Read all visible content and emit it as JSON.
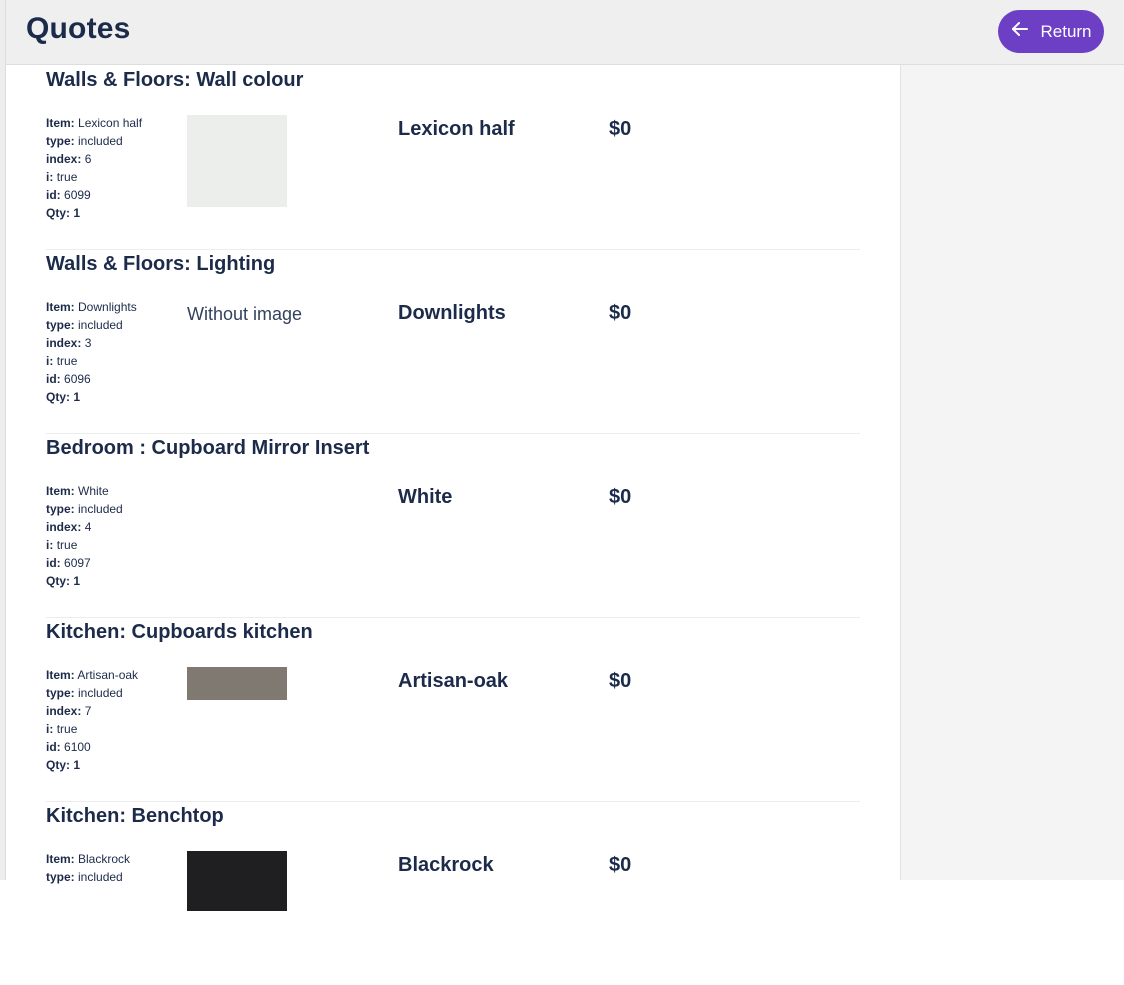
{
  "header": {
    "title": "Quotes",
    "return_label": "Return",
    "accent_color": "#6c3fc4"
  },
  "sections": [
    {
      "title": "Walls & Floors: Wall colour",
      "item": "Lexicon half",
      "type": "included",
      "index": "6",
      "i": "true",
      "id": "6099",
      "qty": "1",
      "name": "Lexicon half",
      "price": "$0",
      "thumb_color": "#eceeec"
    },
    {
      "title": "Walls & Floors: Lighting",
      "item": "Downlights",
      "type": "included",
      "index": "3",
      "i": "true",
      "id": "6096",
      "qty": "1",
      "no_image_text": "Without image",
      "name": "Downlights",
      "price": "$0"
    },
    {
      "title": "Bedroom : Cupboard Mirror Insert",
      "item": "White",
      "type": "included",
      "index": "4",
      "i": "true",
      "id": "6097",
      "qty": "1",
      "name": "White",
      "price": "$0"
    },
    {
      "title": "Kitchen: Cupboards kitchen",
      "item": "Artisan-oak",
      "type": "included",
      "index": "7",
      "i": "true",
      "id": "6100",
      "qty": "1",
      "name": "Artisan-oak",
      "price": "$0",
      "thumb_color": "#7f7971"
    },
    {
      "title": "Kitchen: Benchtop",
      "item": "Blackrock",
      "type": "included",
      "name": "Blackrock",
      "price": "$0",
      "thumb_color": "#1f1f21"
    }
  ],
  "labels": {
    "item": "Item:",
    "type": "type:",
    "index": "index:",
    "i": "i:",
    "id": "id:",
    "qty": "Qty:"
  }
}
